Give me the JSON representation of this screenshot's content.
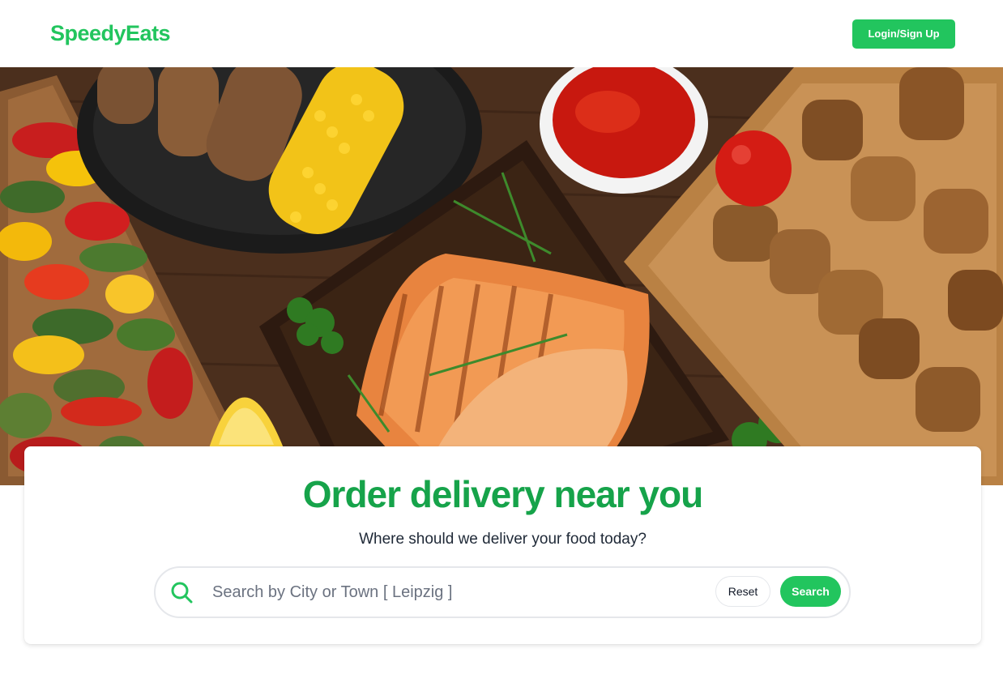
{
  "header": {
    "brand": "SpeedyEats",
    "login_label": "Login/Sign Up"
  },
  "hero": {
    "image_subject": "grilled food spread"
  },
  "card": {
    "headline": "Order delivery near you",
    "subline": "Where should we deliver your food today?"
  },
  "search": {
    "placeholder": "Search by City or Town [ Leipzig ]",
    "value": "",
    "icon": "search-icon",
    "reset_label": "Reset",
    "search_label": "Search"
  },
  "colors": {
    "brand": "#22c55e",
    "headline": "#16a34a",
    "text": "#1f2937"
  }
}
